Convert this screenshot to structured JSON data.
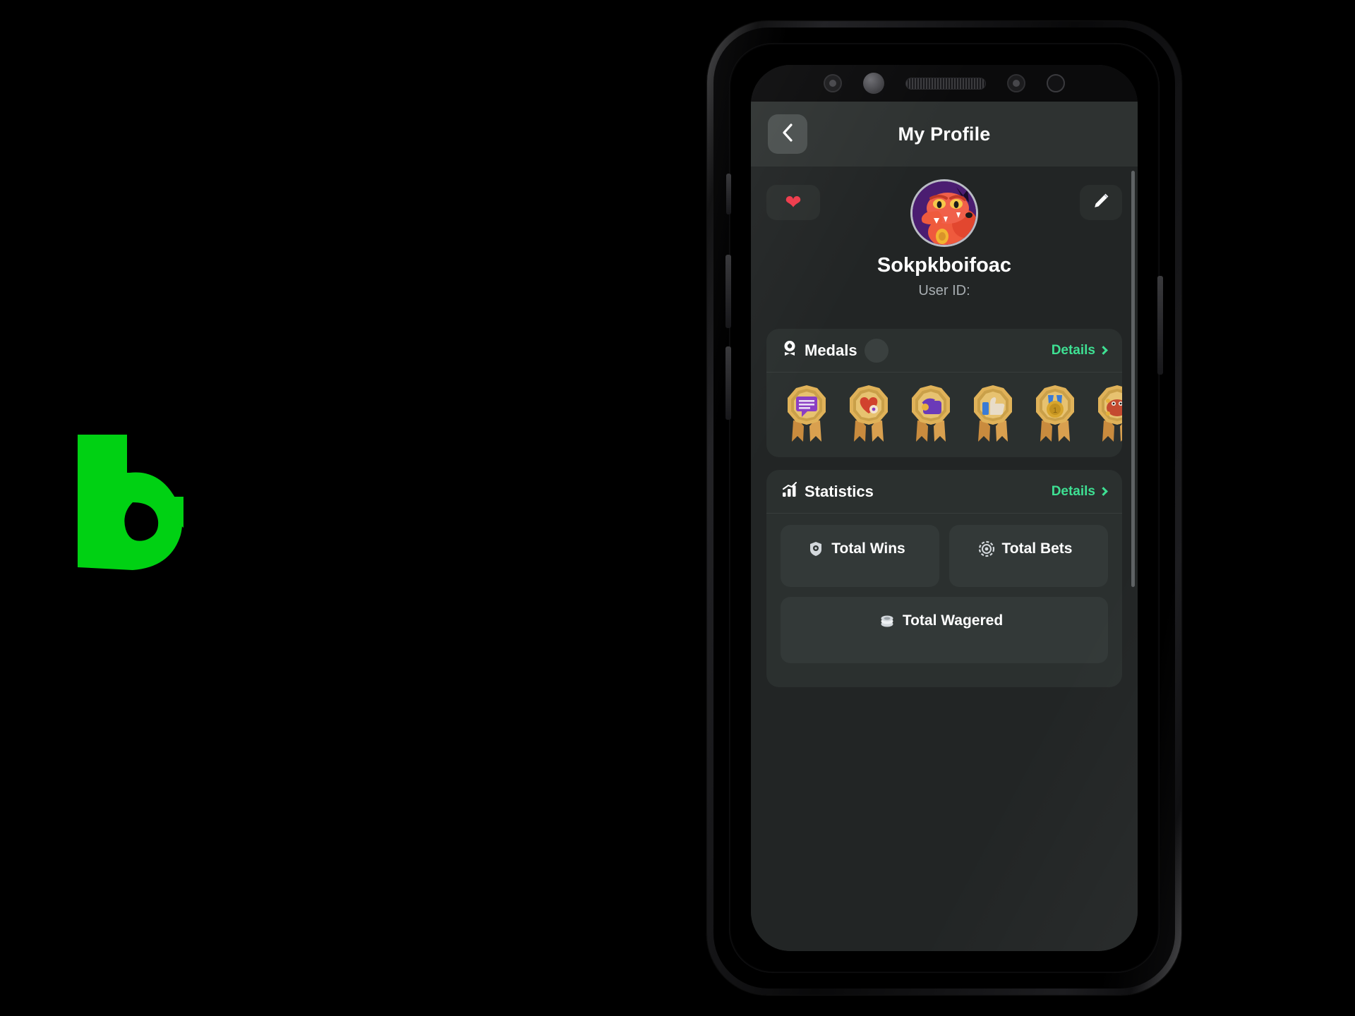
{
  "brand": {
    "logo_name": "b-logo",
    "logo_color": "#00d113"
  },
  "device": {
    "sensors": [
      "camera-sensor",
      "proximity-sensor",
      "earpiece-speaker",
      "camera-sensor",
      "light-sensor"
    ]
  },
  "header": {
    "title": "My Profile",
    "back_icon": "chevron-left-icon"
  },
  "profile": {
    "favorite_icon": "heart-icon",
    "edit_icon": "pencil-icon",
    "avatar_alt": "dragon-avatar",
    "username": "Sokpkboifoac",
    "user_id_label": "User ID:",
    "user_id_value": ""
  },
  "medals": {
    "icon": "medal-icon",
    "title": "Medals",
    "count_placeholder": "",
    "details_label": "Details",
    "details_chevron": "chevron-right-icon",
    "items": [
      {
        "name": "chat-medal",
        "inner": "#8b3fc4",
        "accent": "#ffffff"
      },
      {
        "name": "heart-medal",
        "inner": "#d1422e",
        "accent": "#f3e4d0"
      },
      {
        "name": "wallet-medal",
        "inner": "#6b3ab8",
        "accent": "#e8b23c"
      },
      {
        "name": "thumbsup-medal",
        "inner": "#e8dcc8",
        "accent": "#3a7bd5"
      },
      {
        "name": "first-place-medal",
        "inner": "#d8a62e",
        "accent": "#3a7bd5"
      },
      {
        "name": "dragon-medal",
        "inner": "#c44a30",
        "accent": "#e8b23c"
      },
      {
        "name": "dragon-medal-2",
        "inner": "#c44a30",
        "accent": "#e8b23c"
      }
    ]
  },
  "statistics": {
    "icon": "bar-chart-icon",
    "title": "Statistics",
    "details_label": "Details",
    "details_chevron": "chevron-right-icon",
    "cards": [
      {
        "label": "Total Wins",
        "icon": "win-badge-icon",
        "value": ""
      },
      {
        "label": "Total Bets",
        "icon": "chip-icon",
        "value": ""
      },
      {
        "label": "Total Wagered",
        "icon": "coin-stack-icon",
        "value": ""
      }
    ]
  },
  "colors": {
    "accent_green": "#3ee093",
    "screen_bg": "#222525",
    "card_bg": "#2b302f",
    "header_bg": "#2e3231",
    "heart_red": "#ee3b4b"
  }
}
